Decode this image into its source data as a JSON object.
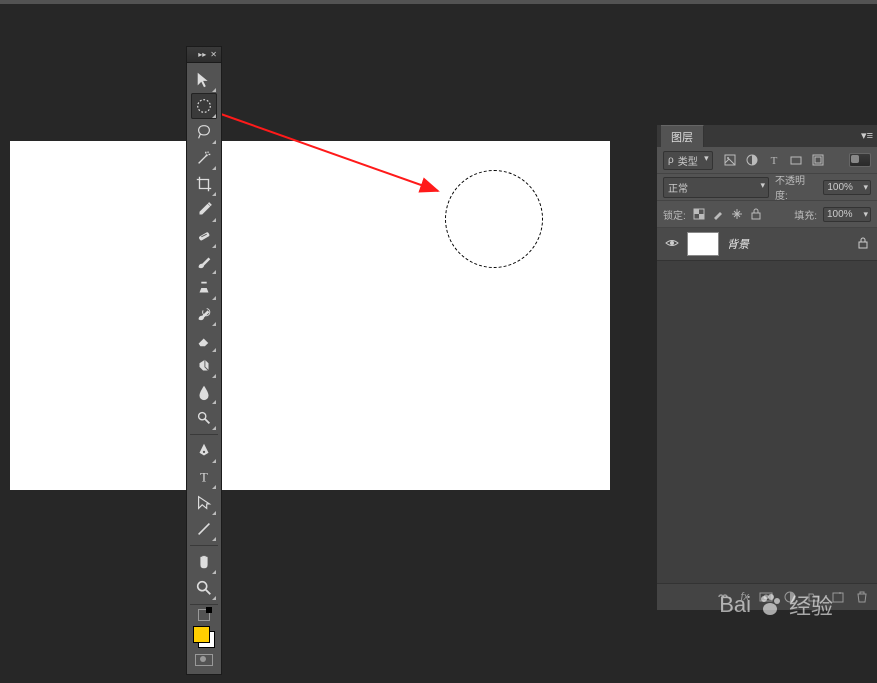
{
  "toolbox": {
    "tools": [
      {
        "name": "move-tool",
        "icon": "move"
      },
      {
        "name": "marquee-tool",
        "icon": "marquee",
        "selected": true
      },
      {
        "name": "lasso-tool",
        "icon": "lasso"
      },
      {
        "name": "magic-wand-tool",
        "icon": "wand"
      },
      {
        "name": "crop-tool",
        "icon": "crop"
      },
      {
        "name": "eyedropper-tool",
        "icon": "eyedropper"
      },
      {
        "name": "healing-brush-tool",
        "icon": "bandage"
      },
      {
        "name": "brush-tool",
        "icon": "brush"
      },
      {
        "name": "clone-stamp-tool",
        "icon": "stamp"
      },
      {
        "name": "history-brush-tool",
        "icon": "historybrush"
      },
      {
        "name": "eraser-tool",
        "icon": "eraser"
      },
      {
        "name": "gradient-tool",
        "icon": "bucket"
      },
      {
        "name": "blur-tool",
        "icon": "blur"
      },
      {
        "name": "dodge-tool",
        "icon": "dodge"
      },
      {
        "name": "pen-tool",
        "icon": "pen"
      },
      {
        "name": "type-tool",
        "icon": "type"
      },
      {
        "name": "path-selection-tool",
        "icon": "pathsel"
      },
      {
        "name": "shape-tool",
        "icon": "line"
      },
      {
        "name": "hand-tool",
        "icon": "hand"
      },
      {
        "name": "zoom-tool",
        "icon": "zoom"
      }
    ],
    "foreground_color": "#ffce00",
    "background_color": "#ffffff"
  },
  "layers_panel": {
    "title": "图层",
    "filter_label": "类型",
    "blend_mode": "正常",
    "opacity_label": "不透明度:",
    "opacity_value": "100%",
    "lock_label": "锁定:",
    "fill_label": "填充:",
    "fill_value": "100%",
    "layers": [
      {
        "name": "背景",
        "visible": true,
        "locked": true
      }
    ]
  },
  "watermark": {
    "text_prefix": "Bai",
    "text_suffix": "经验"
  }
}
